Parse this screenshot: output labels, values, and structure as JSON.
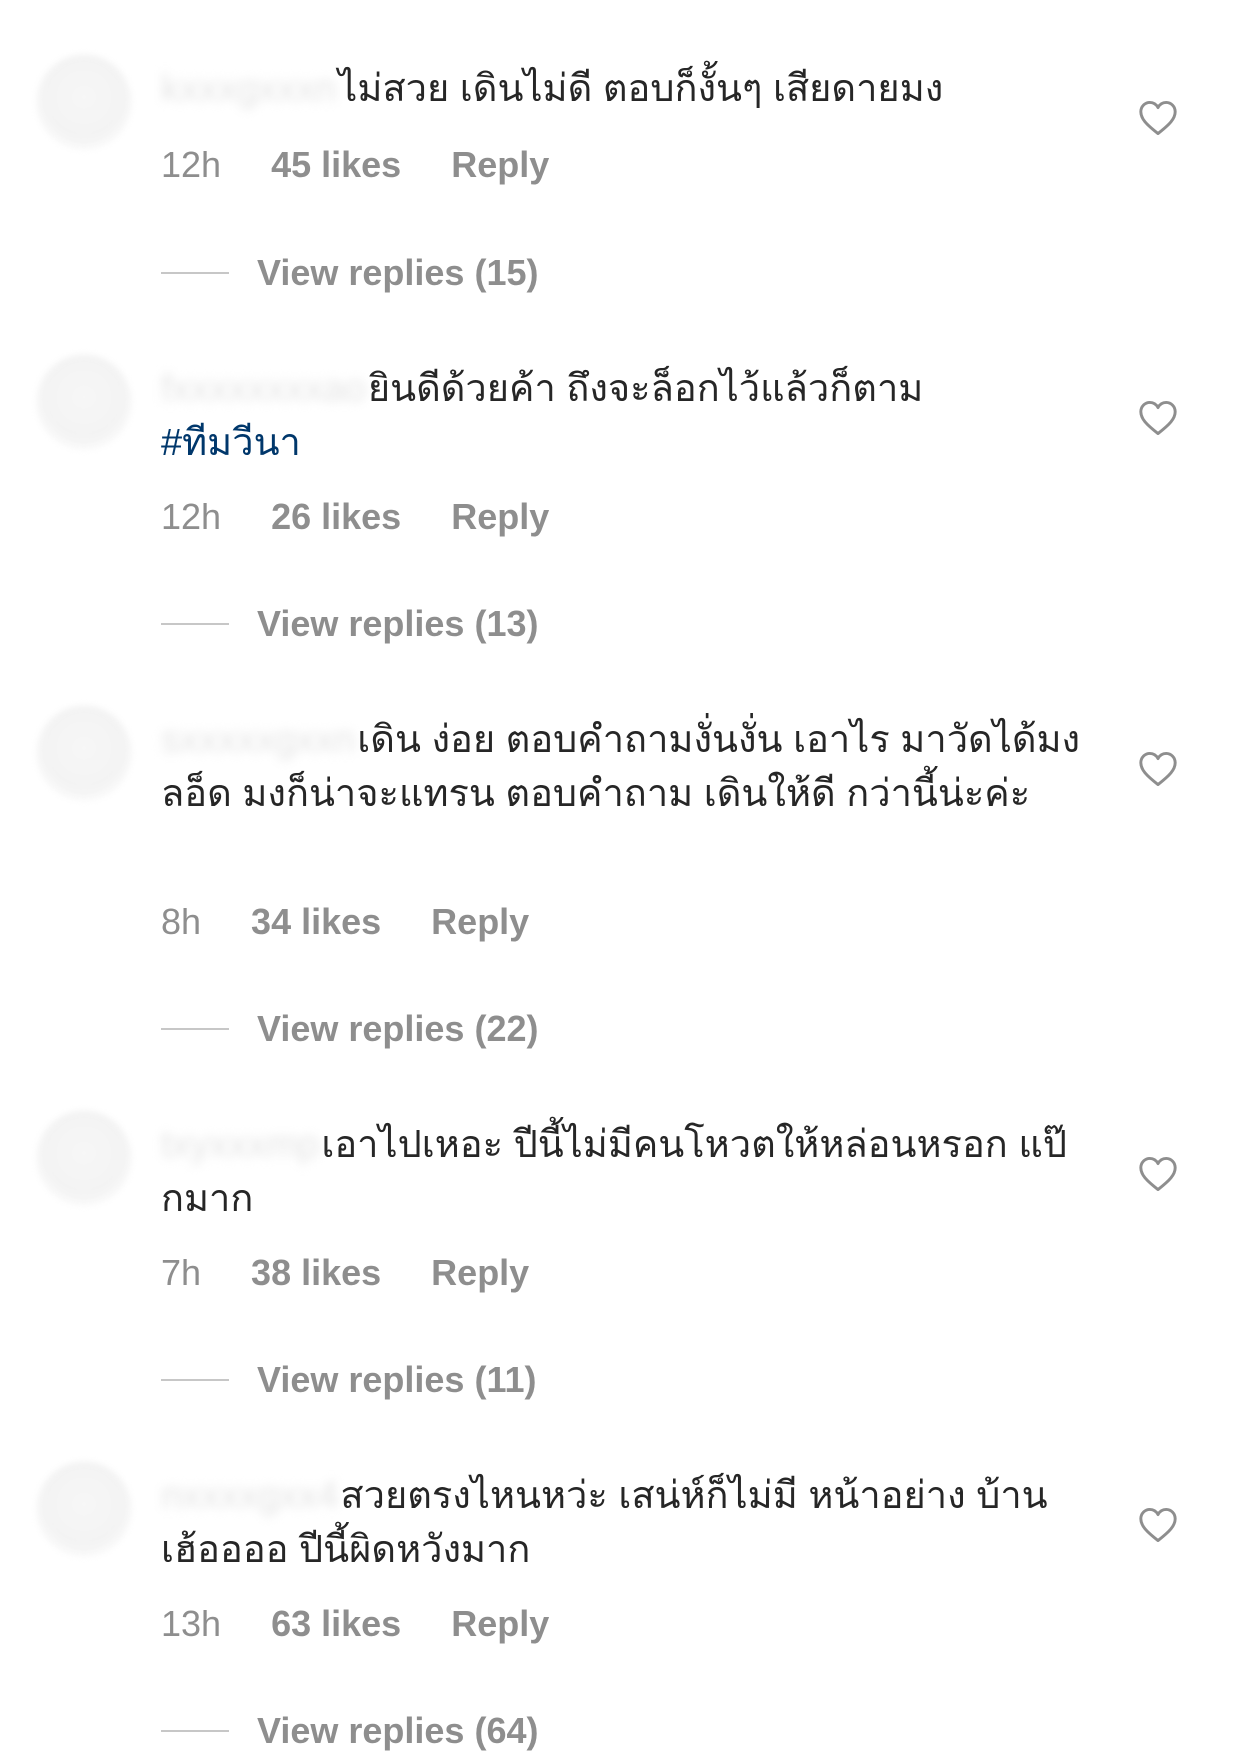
{
  "comments": [
    {
      "username": "kxxxgxxxn",
      "text": "ไม่สวย เดินไม่ดี ตอบก็งั้นๆ เสียดายมง",
      "time": "12h",
      "likes": "45 likes",
      "reply": "Reply",
      "view_replies": "View replies (15)"
    },
    {
      "username": "fxxxxxxxxao",
      "text": "ยินดีด้วยค้า ถึงจะล็อกไว้แล้วก็ตาม",
      "hashtag": "#ทีมวีนา",
      "time": "12h",
      "likes": "26 likes",
      "reply": "Reply",
      "view_replies": "View replies (13)"
    },
    {
      "username": "sxxxxxgxxn",
      "text": "เดิน ง่อย ตอบคำถามงั่นงั่น เอาไร มาวัดได้มง ลอ็ด มงก็น่าจะแทรน ตอบคำถาม เดินให้ดี กว่านี้น่ะค่ะ",
      "time": "8h",
      "likes": "34 likes",
      "reply": "Reply",
      "view_replies": "View replies (22)"
    },
    {
      "username": "txyxxxmp",
      "text": "เอาไปเหอะ ปีนี้ไม่มีคนโหวตให้หล่อนหรอก แป๊กมาก",
      "time": "7h",
      "likes": "38 likes",
      "reply": "Reply",
      "view_replies": "View replies (11)"
    },
    {
      "username": "nxxxxgxx4",
      "text": "สวยตรงไหนหว่ะ เสน่ห์ก็ไม่มี หน้าอย่าง บ้าน เฮ้ออออ ปีนี้ผิดหวังมาก",
      "time": "13h",
      "likes": "63 likes",
      "reply": "Reply",
      "view_replies": "View replies (64)"
    }
  ],
  "icons": {
    "like": "heart-outline-icon"
  },
  "colors": {
    "text": "#262626",
    "meta": "#8e8e8e",
    "hashtag": "#00376b",
    "divider": "#c7c7c7"
  }
}
